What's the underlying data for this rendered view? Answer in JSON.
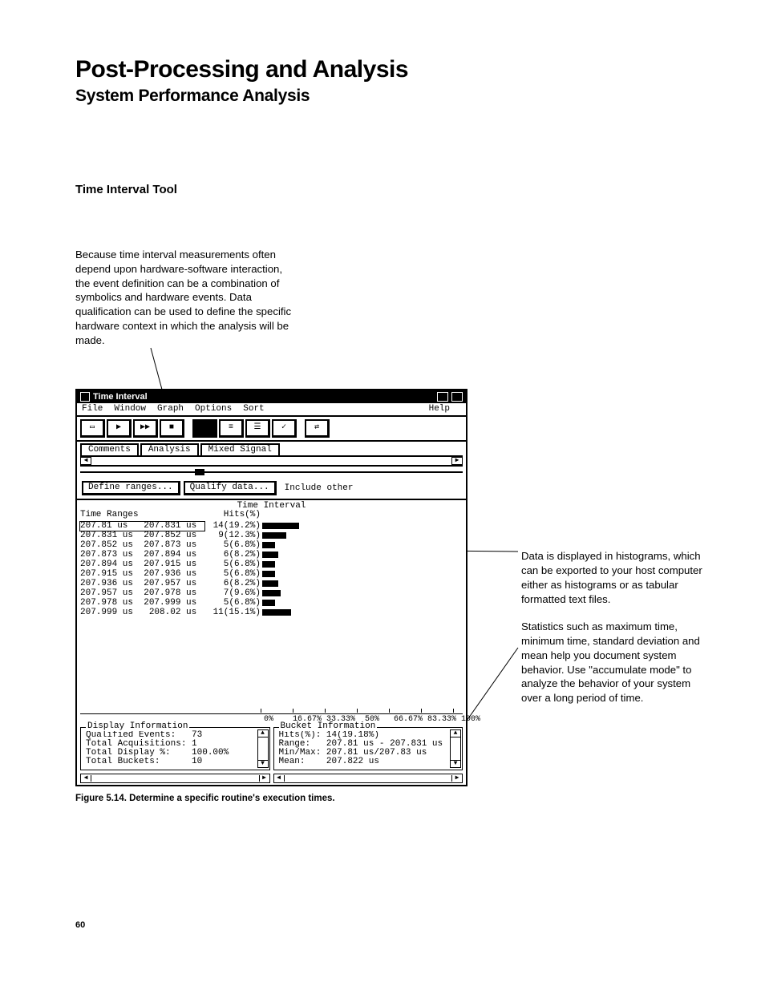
{
  "heading1": "Post-Processing and Analysis",
  "heading2": "System Performance Analysis",
  "heading3": "Time Interval Tool",
  "intro": "Because time interval measurements often depend upon hardware-software interaction, the event definition can be a combination of symbolics and hardware events. Data qualification can be used to define the specific hardware context in which the analysis will be made.",
  "annot1": "Data is displayed in histograms, which can be exported to your host computer either as histograms or as tabular formatted text files.",
  "annot2": "Statistics such as maximum time, minimum time, standard deviation and mean help you document system behavior. Use \"accumulate mode\" to analyze the behavior of your system over a long period of time.",
  "caption": "Figure 5.14. Determine a specific routine's execution times.",
  "page_number": "60",
  "win": {
    "title": "Time Interval",
    "menus": [
      "File",
      "Window",
      "Graph",
      "Options",
      "Sort"
    ],
    "menu_help": "Help",
    "tabs": [
      "Comments",
      "Analysis",
      "Mixed Signal"
    ],
    "opts": {
      "define_ranges": "Define ranges...",
      "qualify_data": "Qualify data...",
      "include_other": "Include other"
    },
    "section_title": "Time Interval",
    "col_ranges": "Time Ranges",
    "col_hits": "Hits(%)",
    "rows": [
      {
        "from": "207.81 us",
        "to": "207.831 us",
        "hits": "14(19.2%)",
        "pct": 19.2
      },
      {
        "from": "207.831 us",
        "to": "207.852 us",
        "hits": "9(12.3%)",
        "pct": 12.3
      },
      {
        "from": "207.852 us",
        "to": "207.873 us",
        "hits": "5(6.8%)",
        "pct": 6.8
      },
      {
        "from": "207.873 us",
        "to": "207.894 us",
        "hits": "6(8.2%)",
        "pct": 8.2
      },
      {
        "from": "207.894 us",
        "to": "207.915 us",
        "hits": "5(6.8%)",
        "pct": 6.8
      },
      {
        "from": "207.915 us",
        "to": "207.936 us",
        "hits": "5(6.8%)",
        "pct": 6.8
      },
      {
        "from": "207.936 us",
        "to": "207.957 us",
        "hits": "6(8.2%)",
        "pct": 8.2
      },
      {
        "from": "207.957 us",
        "to": "207.978 us",
        "hits": "7(9.6%)",
        "pct": 9.6
      },
      {
        "from": "207.978 us",
        "to": "207.999 us",
        "hits": "5(6.8%)",
        "pct": 6.8
      },
      {
        "from": "207.999 us",
        "to": "208.02 us",
        "hits": "11(15.1%)",
        "pct": 15.1
      }
    ],
    "axis_labels": "0%    16.67% 33.33%  50%   66.67% 83.33% 100%",
    "display": {
      "legend": "Display Information",
      "l1": "Qualified Events:   73",
      "l2": "Total Acquisitions: 1",
      "l3": "Total Display %:    100.00%",
      "l4": "Total Buckets:      10"
    },
    "bucket": {
      "legend": "Bucket Information",
      "l1": "Hits(%): 14(19.18%)",
      "l2": "Range:   207.81 us - 207.831 us",
      "l3": "Min/Max: 207.81 us/207.83 us",
      "l4": "Mean:    207.822 us"
    }
  },
  "chart_data": {
    "type": "bar",
    "title": "Time Interval",
    "xlabel": "Hits(%)",
    "ylabel": "Time Ranges",
    "xlim": [
      0,
      100
    ],
    "categories": [
      "207.81 us – 207.831 us",
      "207.831 us – 207.852 us",
      "207.852 us – 207.873 us",
      "207.873 us – 207.894 us",
      "207.894 us – 207.915 us",
      "207.915 us – 207.936 us",
      "207.936 us – 207.957 us",
      "207.957 us – 207.978 us",
      "207.978 us – 207.999 us",
      "207.999 us – 208.02 us"
    ],
    "values": [
      19.2,
      12.3,
      6.8,
      8.2,
      6.8,
      6.8,
      8.2,
      9.6,
      6.8,
      15.1
    ],
    "x_ticks": [
      0,
      16.67,
      33.33,
      50,
      66.67,
      83.33,
      100
    ]
  }
}
